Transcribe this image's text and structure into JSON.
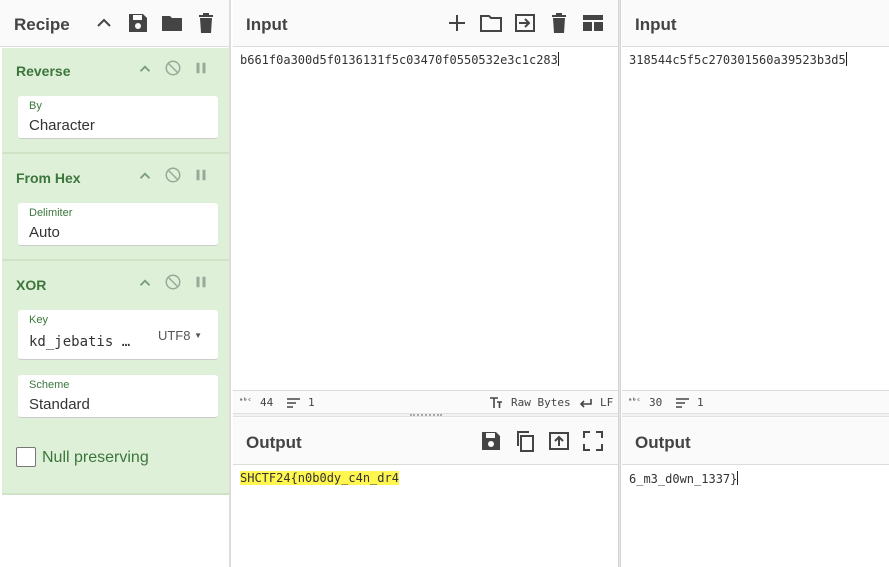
{
  "recipe": {
    "title": "Recipe",
    "icons": [
      "chevron-up-icon",
      "save-icon",
      "folder-icon",
      "trash-icon"
    ],
    "operations": [
      {
        "name": "Reverse",
        "args": [
          {
            "label": "By",
            "value": "Character"
          }
        ]
      },
      {
        "name": "From Hex",
        "args": [
          {
            "label": "Delimiter",
            "value": "Auto"
          }
        ]
      },
      {
        "name": "XOR",
        "args": [
          {
            "label": "Key",
            "value": "kd_jebatis …",
            "encoding": "UTF8"
          },
          {
            "label": "Scheme",
            "value": "Standard"
          }
        ]
      }
    ],
    "null_preserving_label": "Null preserving",
    "null_preserving_checked": false
  },
  "left": {
    "input": {
      "title": "Input",
      "text": "b661f0a300d5f0136131f5c03470f0550532e3c1c283",
      "length": "44",
      "lines": "1",
      "mode_label": "Raw Bytes",
      "eol_label": "LF"
    },
    "output": {
      "title": "Output",
      "text": "SHCTF24{n0b0dy_c4n_dr4"
    }
  },
  "right": {
    "input": {
      "title": "Input",
      "text": "318544c5f5c270301560a39523b3d5",
      "length": "30",
      "lines": "1"
    },
    "output": {
      "title": "Output",
      "text": "6_m3_d0wn_1337}"
    }
  },
  "colors": {
    "op_background": "#dff0d8",
    "op_text": "#3c763d",
    "highlight": "#fff650"
  }
}
